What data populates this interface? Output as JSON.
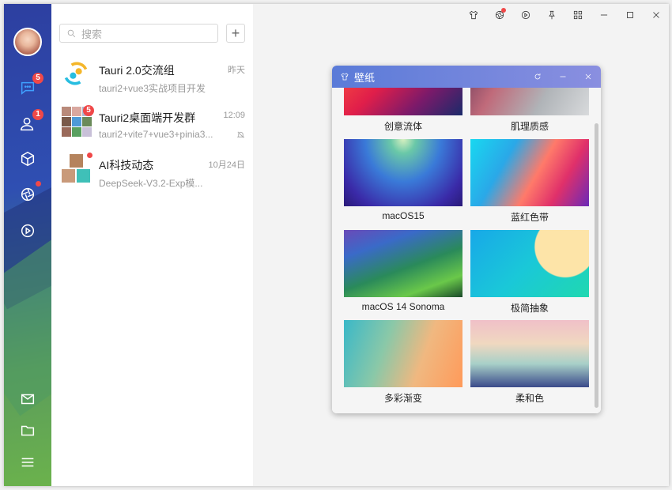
{
  "window": {
    "title": ""
  },
  "rail": {
    "items": [
      {
        "icon": "chat-bubble-icon",
        "badge": "5"
      },
      {
        "icon": "contacts-icon",
        "badge": "1"
      },
      {
        "icon": "cube-icon",
        "badge": ""
      },
      {
        "icon": "aperture-icon",
        "badge": ""
      },
      {
        "icon": "play-circle-icon",
        "badge": ""
      },
      {
        "icon": "mail-icon",
        "badge": ""
      },
      {
        "icon": "folder-icon",
        "badge": ""
      },
      {
        "icon": "menu-icon",
        "badge": ""
      }
    ]
  },
  "chatlist": {
    "search_placeholder": "搜索",
    "add_label": "+",
    "chats": [
      {
        "name": "Tauri 2.0交流组",
        "time": "昨天",
        "preview": "tauri2+vue3实战项目开发",
        "badge": "",
        "muted": false
      },
      {
        "name": "Tauri2桌面端开发群",
        "time": "12:09",
        "preview": "tauri2+vite7+vue3+pinia3...",
        "badge": "5",
        "muted": true
      },
      {
        "name": "AI科技动态",
        "time": "10月24日",
        "preview": "DeepSeek-V3.2-Exp模...",
        "badge": "",
        "muted": false
      }
    ]
  },
  "dialog": {
    "title": "壁纸",
    "wallpapers": [
      {
        "caption": "创意流体"
      },
      {
        "caption": "肌理质感"
      },
      {
        "caption": "macOS15"
      },
      {
        "caption": "蓝红色带"
      },
      {
        "caption": "macOS 14 Sonoma"
      },
      {
        "caption": "极简抽象"
      },
      {
        "caption": "多彩渐变"
      },
      {
        "caption": "柔和色"
      }
    ]
  },
  "colors": {
    "accent": "#3fa0ff",
    "badge": "#f04848",
    "dialog_header": "#6f86dc"
  }
}
